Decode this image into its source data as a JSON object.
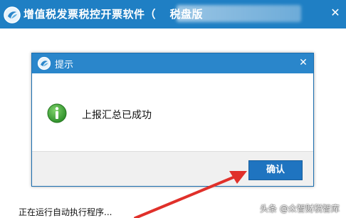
{
  "main_window": {
    "title": "增值税发票税控开票软件（",
    "title_suffix": "税盘版",
    "close_symbol": "✕",
    "status_text": "正在运行自动执行程序...",
    "titlebar_color": "#1f7fc4"
  },
  "dialog": {
    "title": "提示",
    "close_symbol": "✕",
    "message": "上报汇总已成功",
    "icon": "info-icon",
    "confirm_label": "确认",
    "titlebar_color": "#2a86cb",
    "button_color": "#1f74c0"
  },
  "annotation": {
    "arrow_color": "#e0302a"
  },
  "watermark": {
    "text": "头条 @众智财税智库"
  }
}
